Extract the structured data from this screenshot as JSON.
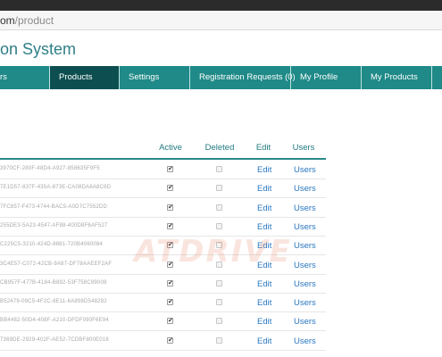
{
  "browser": {
    "address_host": "om",
    "address_path": "/product"
  },
  "app": {
    "title": "on System"
  },
  "nav": {
    "items": [
      {
        "label": "rs",
        "active": false
      },
      {
        "label": "Products",
        "active": true
      },
      {
        "label": "Settings",
        "active": false
      },
      {
        "label": "Registration Requests (0)",
        "active": false
      },
      {
        "label": "My Profile",
        "active": false
      },
      {
        "label": "My Products",
        "active": false
      }
    ]
  },
  "table": {
    "headers": {
      "active": "Active",
      "deleted": "Deleted",
      "edit": "Edit",
      "users": "Users"
    },
    "rows": [
      {
        "id": "3970CF-280F-48D4-A927-858635F9F5",
        "active": true,
        "deleted": false,
        "edit": "Edit",
        "users": "Users"
      },
      {
        "id": "7E1D57-837F-435A-873E-CA08DA6A8C8D",
        "active": true,
        "deleted": false,
        "edit": "Edit",
        "users": "Users"
      },
      {
        "id": "7FC857-F473-4744-BAC5-A0D7C7552DD",
        "active": true,
        "deleted": false,
        "edit": "Edit",
        "users": "Users"
      },
      {
        "id": "255DE3-5A23-4547-AF88-400D8F6AF527",
        "active": true,
        "deleted": false,
        "edit": "Edit",
        "users": "Users"
      },
      {
        "id": "C225C5-3210-424D-8881-720B4060084",
        "active": true,
        "deleted": false,
        "edit": "Edit",
        "users": "Users"
      },
      {
        "id": "3C4E57-C072-42CB-9A87-DF78AAEEF2AF",
        "active": true,
        "deleted": false,
        "edit": "Edit",
        "users": "Users"
      },
      {
        "id": "CB957F-477B-4184-B892-53F758C99008",
        "active": true,
        "deleted": false,
        "edit": "Edit",
        "users": "Users"
      },
      {
        "id": "B52479-09C5-4F2C-8E11-6A898D548282",
        "active": true,
        "deleted": false,
        "edit": "Edit",
        "users": "Users"
      },
      {
        "id": "BB4482-50D4-408F-A210-DFDF090F6E94",
        "active": true,
        "deleted": false,
        "edit": "Edit",
        "users": "Users"
      },
      {
        "id": "7369DE-2929-402F-AE52-7CDBF800E018",
        "active": true,
        "deleted": false,
        "edit": "Edit",
        "users": "Users"
      }
    ]
  },
  "watermark": {
    "text": "ATDRIVE"
  }
}
